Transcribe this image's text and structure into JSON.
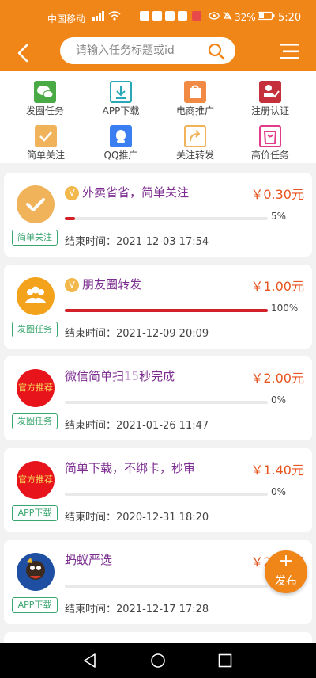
{
  "status_bar": {
    "carrier": "中国移动",
    "battery_pct": "32%",
    "time": "5:20"
  },
  "header": {
    "search_placeholder": "请输入任务标题或id"
  },
  "categories": [
    {
      "label": "发圈任务",
      "icon": "wechat-moments-icon",
      "color": "#4aaa45"
    },
    {
      "label": "APP下载",
      "icon": "download-icon",
      "color": "#2aa8b8"
    },
    {
      "label": "电商推广",
      "icon": "shop-icon",
      "color": "#f08a45"
    },
    {
      "label": "注册认证",
      "icon": "register-icon",
      "color": "#c4303c"
    },
    {
      "label": "简单关注",
      "icon": "check-icon",
      "color": "#f0b35a"
    },
    {
      "label": "QQ推广",
      "icon": "qq-icon",
      "color": "#3a7ef2"
    },
    {
      "label": "关注转发",
      "icon": "share-icon",
      "color": "#f0b35a"
    },
    {
      "label": "高价任务",
      "icon": "bag-icon",
      "color": "#e03c8a"
    }
  ],
  "tasks": [
    {
      "title": "外卖省省，简单关注",
      "vip": "V",
      "price": "￥0.30元",
      "progress_label": "5%",
      "progress": 0.05,
      "end_time": "结束时间：2021-12-03 17:54",
      "tag": "简单关注",
      "avatar": "check-avatar"
    },
    {
      "title": "朋友圈转发",
      "vip": "V",
      "price": "￥1.00元",
      "progress_label": "100%",
      "progress": 1.0,
      "end_time": "结束时间：2021-12-09 20:09",
      "tag": "发圈任务",
      "avatar": "group-avatar"
    },
    {
      "title_pre": "微信简单扫",
      "title_num": "15",
      "title_post": "秒完成",
      "price": "￥2.00元",
      "progress_label": "0%",
      "progress": 0,
      "end_time": "结束时间：2021-01-26 11:47",
      "tag": "发圈任务",
      "avatar_text": "官方推荐"
    },
    {
      "title": "简单下载，不绑卡，秒审",
      "price": "￥1.40元",
      "progress_label": "0%",
      "progress": 0,
      "end_time": "结束时间：2020-12-31 18:20",
      "tag": "APP下载",
      "avatar_text": "官方推荐"
    },
    {
      "title": "蚂蚁严选",
      "price": "￥2.00元",
      "end_time": "结束时间：2021-12-17 17:28",
      "tag": "APP下载",
      "avatar": "mascot-avatar"
    }
  ],
  "fab": {
    "label": "发布"
  },
  "colors": {
    "brand": "#f08518",
    "title": "#7c2d8f",
    "price": "#e8541e",
    "progress": "#d3212a",
    "tag": "#3aa66f"
  }
}
